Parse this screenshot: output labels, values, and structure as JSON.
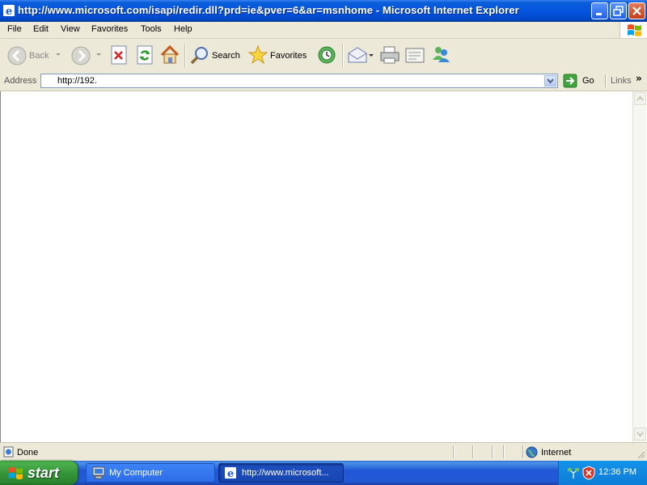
{
  "window": {
    "title": "http://www.microsoft.com/isapi/redir.dll?prd=ie&pver=6&ar=msnhome - Microsoft Internet Explorer"
  },
  "menu": [
    "File",
    "Edit",
    "View",
    "Favorites",
    "Tools",
    "Help"
  ],
  "toolbar": {
    "back_label": "Back",
    "search_label": "Search",
    "favorites_label": "Favorites"
  },
  "address": {
    "label": "Address",
    "value": "http://192.",
    "go_label": "Go",
    "links_label": "Links"
  },
  "status": {
    "text": "Done",
    "zone": "Internet"
  },
  "taskbar": {
    "start_label": "start",
    "tasks": [
      "My Computer",
      "http://www.microsoft..."
    ],
    "clock": "12:36 PM"
  },
  "colors": {
    "title_bar": "#0554e0",
    "chrome": "#ece9d8",
    "taskbar": "#2258d6",
    "start_button": "#36963b",
    "tray": "#1288e0"
  }
}
